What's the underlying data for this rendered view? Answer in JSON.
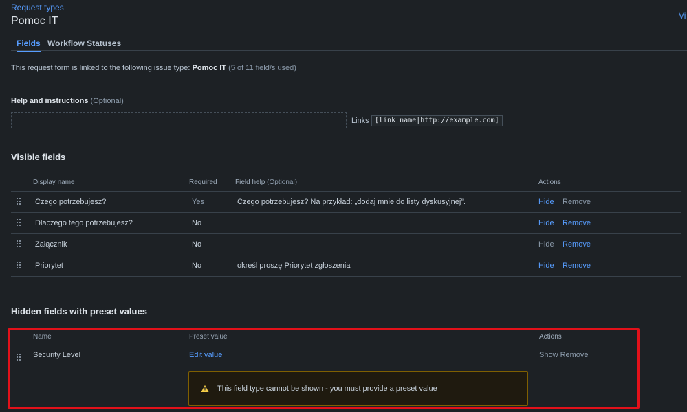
{
  "breadcrumb": "Request types",
  "page_title": "Pomoc IT",
  "header_right_link": "Vi",
  "tabs": {
    "fields": "Fields",
    "workflow": "Workflow Statuses"
  },
  "linked": {
    "prefix": "This request form is linked to the following issue type:",
    "issue_type": "Pomoc IT",
    "usage": "(5 of 11 field/s used)"
  },
  "help": {
    "heading": "Help and instructions",
    "optional": "(Optional)",
    "value": "",
    "links_label": "Links",
    "links_code": "[link name|http://example.com]"
  },
  "visible_fields": {
    "title": "Visible fields",
    "headers": {
      "display_name": "Display name",
      "required": "Required",
      "field_help": "Field help",
      "field_help_optional": "(Optional)",
      "actions": "Actions"
    },
    "rows": [
      {
        "name": "Czego potrzebujesz?",
        "required": "Yes",
        "help": "Czego potrzebujesz? Na przykład: „dodaj mnie do listy dyskusyjnej”.",
        "hide": "Hide",
        "remove": "Remove"
      },
      {
        "name": "Dlaczego tego potrzebujesz?",
        "required": "No",
        "help": "",
        "hide": "Hide",
        "remove": "Remove"
      },
      {
        "name": "Załącznik",
        "required": "No",
        "help": "",
        "hide": "Hide",
        "remove": "Remove"
      },
      {
        "name": "Priorytet",
        "required": "No",
        "help": "określ proszę Priorytet zgłoszenia",
        "hide": "Hide",
        "remove": "Remove"
      }
    ]
  },
  "hidden_fields": {
    "title": "Hidden fields with preset values",
    "headers": {
      "name": "Name",
      "preset": "Preset value",
      "actions": "Actions"
    },
    "rows": [
      {
        "name": "Security Level",
        "preset_action": "Edit value",
        "actions": "Show Remove"
      }
    ],
    "warning": "This field type cannot be shown - you must provide a preset value"
  },
  "colors": {
    "background": "#1d2125",
    "link": "#579dff",
    "highlight": "#e2111a",
    "warning": "#f5cd47"
  }
}
